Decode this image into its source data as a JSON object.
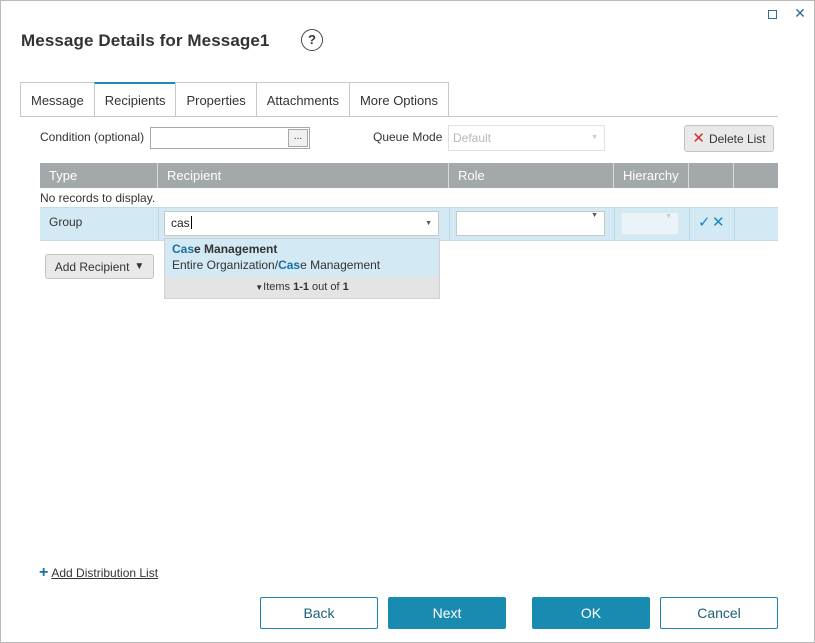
{
  "dialog": {
    "title": "Message Details for Message1",
    "help_glyph": "?",
    "maximize_icon": "maximize-icon",
    "close_glyph": "✕"
  },
  "tabs": [
    {
      "label": "Message",
      "active": false
    },
    {
      "label": "Recipients",
      "active": true
    },
    {
      "label": "Properties",
      "active": false
    },
    {
      "label": "Attachments",
      "active": false
    },
    {
      "label": "More Options",
      "active": false
    }
  ],
  "toolbar": {
    "condition_label": "Condition (optional)",
    "condition_value": "",
    "ellipsis": "...",
    "queue_mode_label": "Queue Mode",
    "queue_mode_value": "Default",
    "delete_list_label": "Delete List",
    "delete_glyph": "✕"
  },
  "grid": {
    "columns": [
      "Type",
      "Recipient",
      "Role",
      "Hierarchy"
    ],
    "empty_text": "No records to display.",
    "edit_row": {
      "type": "Group",
      "recipient_value": "cas",
      "role_value": "",
      "hierarchy_value": ""
    },
    "save_glyph": "✓",
    "cancel_glyph": "✕"
  },
  "recipient_dropdown": {
    "item": {
      "match": "Cas",
      "name_rest": "e Management",
      "path_prefix": "Entire Organization/",
      "path_match": "Cas",
      "path_rest": "e Management"
    },
    "footer": {
      "prefix": "Items ",
      "range": "1-1",
      "mid": " out of ",
      "total": "1"
    }
  },
  "add_recipient_label": "Add Recipient",
  "add_distribution_list_label": "Add Distribution List",
  "buttons": {
    "back": "Back",
    "next": "Next",
    "ok": "OK",
    "cancel": "Cancel"
  },
  "colors": {
    "accent": "#1a8bb0",
    "grid_header": "#a3a8ab",
    "row_highlight": "#d3e9f4",
    "delete_red": "#d32f2f"
  }
}
